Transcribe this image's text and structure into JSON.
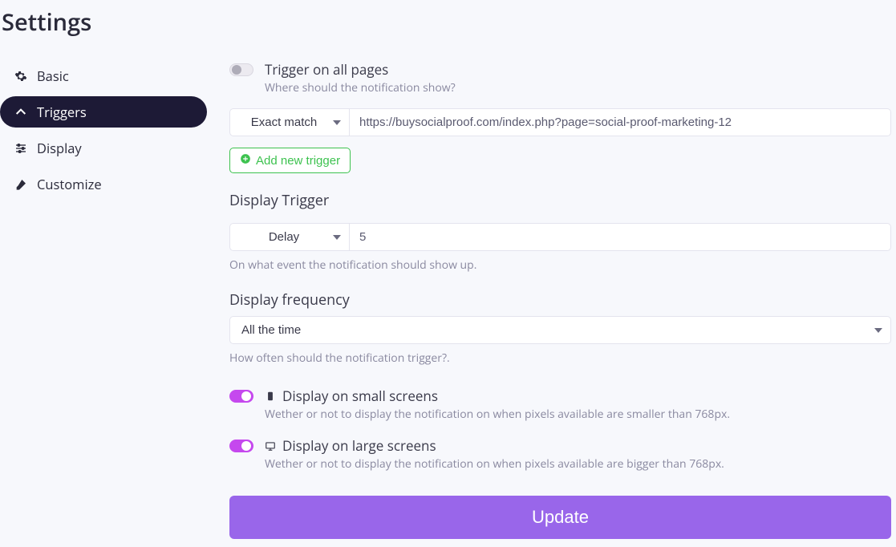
{
  "page_title": "Settings",
  "sidebar": {
    "items": [
      {
        "label": "Basic",
        "icon": "gear-icon",
        "active": false
      },
      {
        "label": "Triggers",
        "icon": "chevron-up-icon",
        "active": true
      },
      {
        "label": "Display",
        "icon": "sliders-icon",
        "active": false
      },
      {
        "label": "Customize",
        "icon": "brush-icon",
        "active": false
      }
    ]
  },
  "trigger_all": {
    "enabled": false,
    "label": "Trigger on all pages",
    "helper": "Where should the notification show?"
  },
  "match_rule": {
    "select_value": "Exact match",
    "url_value": "https://buysocialproof.com/index.php?page=social-proof-marketing-12"
  },
  "add_trigger_label": "Add new trigger",
  "display_trigger": {
    "title": "Display Trigger",
    "select_value": "Delay",
    "input_value": "5",
    "helper": "On what event the notification should show up."
  },
  "display_frequency": {
    "title": "Display frequency",
    "select_value": "All the time",
    "helper": "How often should the notification trigger?."
  },
  "small_screens": {
    "enabled": true,
    "label": "Display on small screens",
    "helper": "Wether or not to display the notification on when pixels available are smaller than 768px."
  },
  "large_screens": {
    "enabled": true,
    "label": "Display on large screens",
    "helper": "Wether or not to display the notification on when pixels available are bigger than 768px."
  },
  "update_label": "Update"
}
